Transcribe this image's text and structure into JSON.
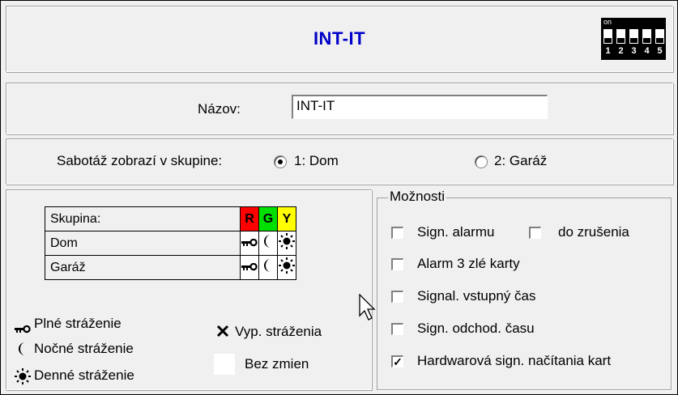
{
  "header": {
    "title": "INT-IT"
  },
  "dip": {
    "on_label": "on",
    "numbers": [
      "1",
      "2",
      "3",
      "4",
      "5"
    ]
  },
  "name_row": {
    "label": "Názov:",
    "value": "INT-IT"
  },
  "tamper_row": {
    "label": "Sabotáž zobrazí v skupine:",
    "options": [
      {
        "label": "1: Dom",
        "selected": true
      },
      {
        "label": "2: Garáž",
        "selected": false
      }
    ]
  },
  "zones_table": {
    "header": {
      "label": "Skupina:",
      "cols": [
        "R",
        "G",
        "Y"
      ]
    },
    "rows": [
      {
        "name": "Dom",
        "icons": [
          "key-icon",
          "moon-icon",
          "sun-icon"
        ]
      },
      {
        "name": "Garáž",
        "icons": [
          "key-icon",
          "moon-icon",
          "sun-icon"
        ]
      }
    ],
    "colors": {
      "R": "#ff0000",
      "G": "#00e000",
      "Y": "#ffff00"
    }
  },
  "legend": {
    "full": "Plné stráženie",
    "night": "Nočné stráženie",
    "day": "Denné stráženie",
    "off": "Vyp. stráženia",
    "nochange": "Bez zmien"
  },
  "options": {
    "title": "Možnosti",
    "items": [
      {
        "label": "Sign. alarmu",
        "checked": false
      },
      {
        "label": "do zrušenia",
        "checked": false
      },
      {
        "label": "Alarm 3 zlé karty",
        "checked": false
      },
      {
        "label": "Signal. vstupný čas",
        "checked": false
      },
      {
        "label": "Sign. odchod. času",
        "checked": false
      },
      {
        "label": "Hardwarová sign. načítania kart",
        "checked": true
      }
    ]
  }
}
